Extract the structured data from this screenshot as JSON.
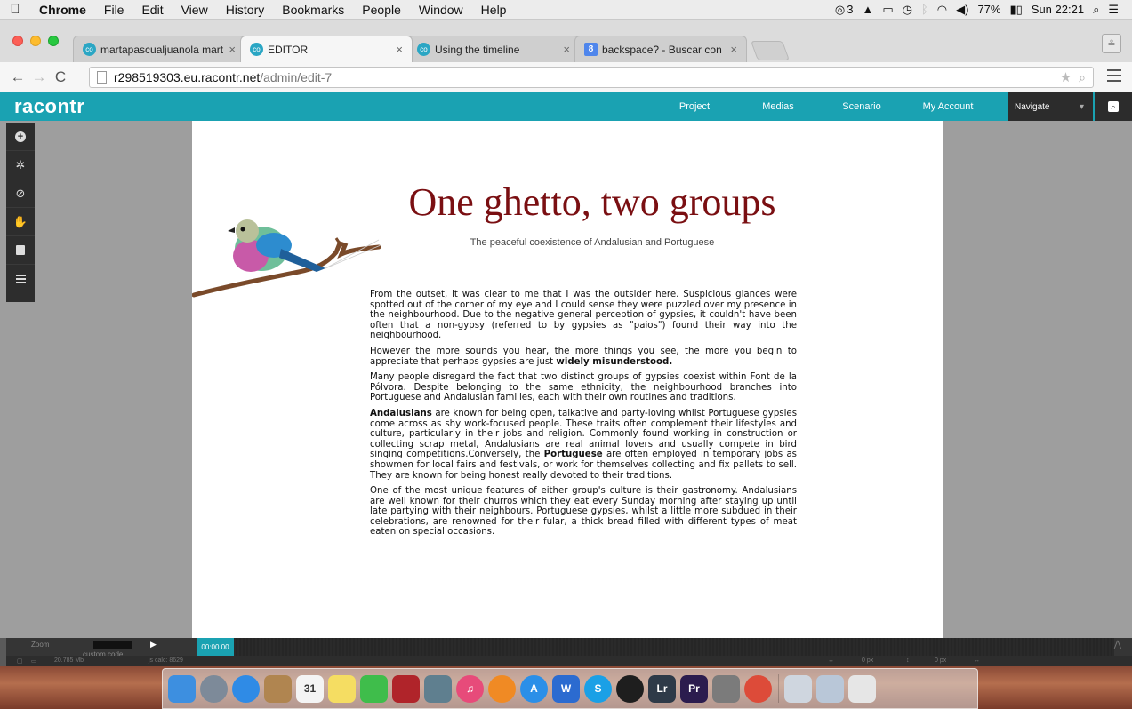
{
  "menubar": {
    "apple": "",
    "items": [
      "Chrome",
      "File",
      "Edit",
      "View",
      "History",
      "Bookmarks",
      "People",
      "Window",
      "Help"
    ],
    "status_left": "3",
    "battery": "77%",
    "clock": "Sun 22:21"
  },
  "tabs": [
    {
      "favicon": "co",
      "title": "martapascualjuanola marta",
      "close": "×"
    },
    {
      "favicon": "co",
      "title": "EDITOR",
      "close": "×"
    },
    {
      "favicon": "co",
      "title": "Using the timeline",
      "close": "×"
    },
    {
      "favicon": "8",
      "title": "backspace? - Buscar con G",
      "close": "×"
    }
  ],
  "address": {
    "host": "r298519303.eu.racontr.net",
    "path": "/admin/edit-7"
  },
  "app": {
    "logo": "racontr",
    "nav": [
      "Project",
      "Medias",
      "Scenario",
      "My Account"
    ],
    "navigate_label": "Navigate",
    "navigate_caret": "▾"
  },
  "tools": [
    "add-icon",
    "gear-icon",
    "link-icon",
    "hand-icon",
    "media-icon",
    "layers-icon"
  ],
  "canvas": {
    "title": "One ghetto, two groups",
    "subtitle": "The peaceful coexistence of Andalusian and Portuguese",
    "p1": "From the outset, it was clear to me that I was the outsider here. Suspicious glances were spotted out of the corner of my eye and I could sense they were puzzled over my presence in the neighbourhood. Due to the negative general perception of gypsies, it couldn't have been often that a non-gypsy (referred to by gypsies as \"paios\") found their way into the neighbourhood.",
    "p2_a": "However the more sounds you hear, the more things you see, the more you begin to appreciate that perhaps gypsies are just ",
    "p2_b": "widely misunderstood.",
    "p3": "Many people disregard the fact that two distinct groups of gypsies coexist within Font de la Pólvora. Despite belonging to the same ethnicity, the neighbourhood branches into Portuguese and Andalusian families, each with their own routines and traditions.",
    "p4_a": "Andalusians",
    "p4_b": " are known for being open, talkative and party-loving whilst Portuguese gypsies come across as shy work-focused people. These traits often complement their lifestyles and culture, particularly in their jobs and religion. Commonly found working in construction or collecting scrap metal, Andalusians are real animal lovers and usually compete in bird singing competitions.Conversely, the ",
    "p4_c": "Portuguese",
    "p4_d": " are often employed in temporary jobs as showmen for local fairs and festivals, or work for themselves collecting and fix pallets to sell. They are known for being honest really  devoted to their traditions.",
    "p5": "One of the most unique features of either group's culture is their gastronomy. Andalusians are well known for their churros which they eat every Sunday morning after staying up until late partying with their neighbours. Portuguese gypsies, whilst a little more subdued in their celebrations, are renowned for their fular, a thick bread filled with different types of meat eaten on special occasions."
  },
  "timeline": {
    "zoom_label": "Zoom",
    "custom_code": "custom code",
    "timecode": "00:00.00",
    "status_mem": "20.785 Mb",
    "status_js": "js calc: 8629",
    "status_x": "0 px",
    "status_y": "0 px"
  },
  "dock": [
    {
      "name": "finder-icon",
      "color": "#3d8fe0",
      "label": ""
    },
    {
      "name": "launchpad-icon",
      "color": "#7d8a99",
      "label": ""
    },
    {
      "name": "safari-icon",
      "color": "#2f8be6",
      "label": ""
    },
    {
      "name": "contacts-icon",
      "color": "#b08550",
      "label": ""
    },
    {
      "name": "calendar-icon",
      "color": "#f4f4f4",
      "label": "31"
    },
    {
      "name": "notes-icon",
      "color": "#f5dd62",
      "label": ""
    },
    {
      "name": "facetime-icon",
      "color": "#3fbd4b",
      "label": ""
    },
    {
      "name": "photo-booth-icon",
      "color": "#b0242a",
      "label": ""
    },
    {
      "name": "image-capture-icon",
      "color": "#5f7f8f",
      "label": ""
    },
    {
      "name": "itunes-icon",
      "color": "#e74b7a",
      "label": "♫"
    },
    {
      "name": "ibooks-icon",
      "color": "#f08a24",
      "label": ""
    },
    {
      "name": "app-store-icon",
      "color": "#2b8fe8",
      "label": "A"
    },
    {
      "name": "word-icon",
      "color": "#2b6bd0",
      "label": "W"
    },
    {
      "name": "skype-icon",
      "color": "#1aa0e6",
      "label": "S"
    },
    {
      "name": "spotify-icon",
      "color": "#1e1e1e",
      "label": ""
    },
    {
      "name": "lightroom-icon",
      "color": "#2e3a48",
      "label": "Lr"
    },
    {
      "name": "premiere-icon",
      "color": "#2b1c4e",
      "label": "Pr"
    },
    {
      "name": "system-preferences-icon",
      "color": "#7b7b7b",
      "label": ""
    },
    {
      "name": "chrome-icon",
      "color": "#dd4b39",
      "label": ""
    },
    {
      "name": "documents-stack-icon",
      "color": "#cfd6df",
      "label": ""
    },
    {
      "name": "downloads-stack-icon",
      "color": "#b9c7d8",
      "label": ""
    },
    {
      "name": "trash-icon",
      "color": "#e6e6e6",
      "label": ""
    }
  ]
}
